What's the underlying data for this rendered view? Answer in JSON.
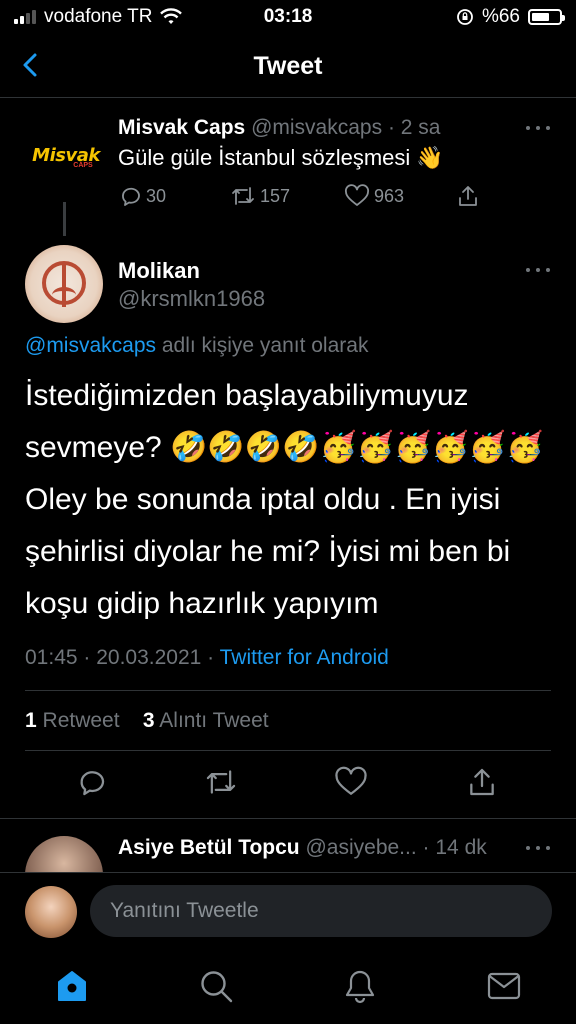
{
  "status_bar": {
    "carrier": "vodafone TR",
    "time": "03:18",
    "battery": "%66",
    "battery_level": 0.66
  },
  "header": {
    "back_icon": "chevron-left-icon",
    "title": "Tweet"
  },
  "parent_tweet": {
    "avatar_logo": "Misvak",
    "avatar_sub": "CAPS",
    "name": "Misvak Caps",
    "handle": "@misvakcaps",
    "time": "· 2 sa",
    "text": "Güle güle İstanbul sözleşmesi 👋",
    "replies": "30",
    "retweets": "157",
    "likes": "963"
  },
  "main_tweet": {
    "name": "Molikan",
    "handle": "@krsmlkn1968",
    "reply_mention": "@misvakcaps",
    "reply_suffix": " adlı kişiye yanıt olarak",
    "text": "İstediğimizden başlayabiliymuyuz sevmeye?  🤣🤣🤣🤣🥳🥳🥳🥳🥳🥳 Oley be sonunda iptal oldu . En iyisi şehirlisi diyolar he mi? İyisi mi ben bi koşu gidip hazırlık yapıyım",
    "timestamp": "01:45 · 20.03.2021 · ",
    "source": "Twitter for Android",
    "retweet_count": "1",
    "retweet_label": " Retweet",
    "quote_count": "3",
    "quote_label": " Alıntı Tweet"
  },
  "next_reply": {
    "name": "Asiye Betül Topcu",
    "handle": "@asiyebe...",
    "time": "· 14 dk"
  },
  "compose": {
    "placeholder": "Yanıtını Tweetle"
  },
  "colors": {
    "accent": "#1d9bf0",
    "muted": "#71767b",
    "background": "#000000"
  },
  "tabbar": {
    "items": [
      "home-icon",
      "search-icon",
      "notifications-icon",
      "messages-icon"
    ]
  }
}
